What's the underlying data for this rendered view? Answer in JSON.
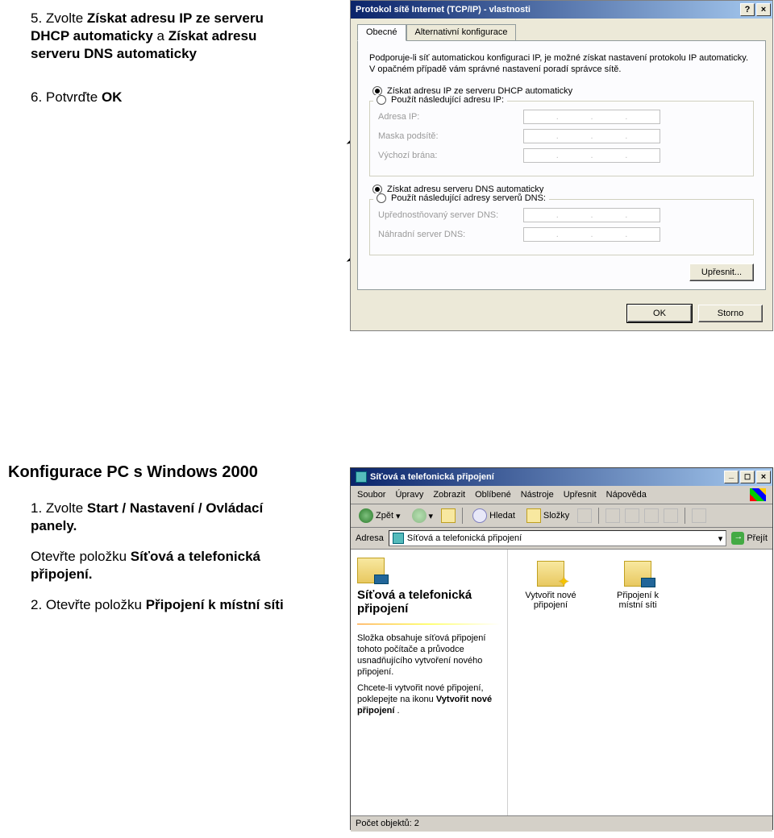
{
  "instructions": {
    "step5_pre": "5. Zvolte ",
    "step5_b1": "Získat adresu IP ze serveru DHCP automaticky",
    "step5_mid": "  a  ",
    "step5_b2": "Získat adresu serveru DNS automaticky",
    "step6": "6. Potvrďte ",
    "step6_b": "OK",
    "heading2": "Konfigurace PC s Windows 2000",
    "step1b_pre": "1. Zvolte  ",
    "step1b_b": "Start / Nastavení / Ovládací panely.",
    "step1c_pre": "Otevřte položku ",
    "step1c_b": "Síťová a telefonická připojení.",
    "step2b_pre": "2. Otevřte  položku ",
    "step2b_b": "Připojení k místní síti"
  },
  "dialog": {
    "title": "Protokol sítě Internet (TCP/IP) - vlastnosti",
    "help": "?",
    "close": "×",
    "tab_active": "Obecné",
    "tab_alt": "Alternativní konfigurace",
    "intro": "Podporuje-li síť automatickou konfiguraci IP, je možné získat nastavení protokolu IP automaticky. V opačném případě vám správné nastavení poradí správce sítě.",
    "radio_dhcp": "Získat adresu IP ze serveru DHCP automaticky",
    "radio_static": "Použít následující adresu IP:",
    "ip_label": "Adresa IP:",
    "mask_label": "Maska podsítě:",
    "gw_label": "Výchozí brána:",
    "radio_dns_auto": "Získat adresu serveru DNS automaticky",
    "radio_dns_static": "Použít následující adresy serverů DNS:",
    "pref_dns": "Upřednostňovaný server DNS:",
    "alt_dns": "Náhradní server DNS:",
    "advanced": "Upřesnit...",
    "ok": "OK",
    "cancel": "Storno"
  },
  "explorer": {
    "title": "Síťová a telefonická připojení",
    "menu": {
      "file": "Soubor",
      "edit": "Úpravy",
      "view": "Zobrazit",
      "fav": "Oblíbené",
      "tools": "Nástroje",
      "adv": "Upřesnit",
      "help": "Nápověda"
    },
    "toolbar": {
      "back": "Zpět",
      "search": "Hledat",
      "folders": "Složky"
    },
    "address_label": "Adresa",
    "address_value": "Síťová a telefonická připojení",
    "go": "Přejít",
    "side": {
      "title": "Síťová a telefonická připojení",
      "p1": "Složka obsahuje síťová připojení tohoto počítače a průvodce usnadňujícího vytvoření nového připojení.",
      "p2a": "Chcete-li vytvořit nové připojení, poklepejte na ikonu ",
      "p2b": "Vytvořit nové připojení",
      "p2c": "."
    },
    "icons": {
      "new1": "Vytvořit nové",
      "new2": "připojení",
      "lan1": "Připojení k",
      "lan2": "místní síti"
    },
    "status": "Počet objektů: 2"
  }
}
